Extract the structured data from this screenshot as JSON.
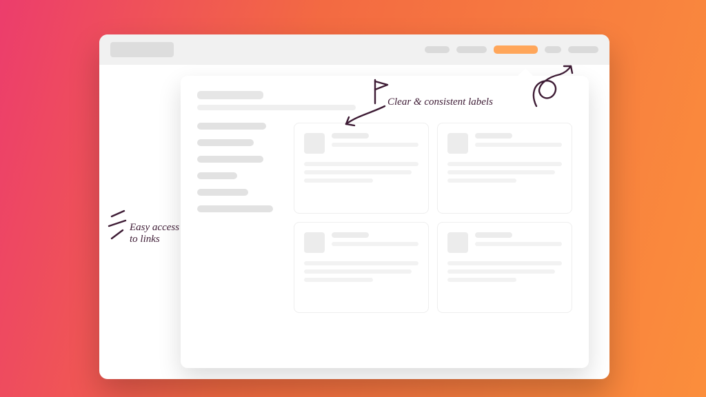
{
  "colors": {
    "gradient_start": "#EC3D6C",
    "gradient_mid": "#F36A42",
    "gradient_end": "#FB8E3C",
    "accent": "#FFA65A",
    "sketch": "#3d1b34"
  },
  "browser": {
    "topbar": {
      "logo_placeholder": "",
      "nav_items": [
        {
          "label": "",
          "active": false
        },
        {
          "label": "",
          "active": false
        },
        {
          "label": "",
          "active": true
        },
        {
          "label": "",
          "active": false
        },
        {
          "label": "",
          "active": false
        }
      ]
    }
  },
  "megamenu": {
    "title_placeholder": "",
    "subtitle_placeholder": "",
    "sidebar_links": [
      "",
      "",
      "",
      "",
      "",
      ""
    ],
    "cards": [
      {
        "thumb": "",
        "title": "",
        "subtitle": "",
        "lines": [
          "",
          "",
          ""
        ]
      },
      {
        "thumb": "",
        "title": "",
        "subtitle": "",
        "lines": [
          "",
          "",
          ""
        ]
      },
      {
        "thumb": "",
        "title": "",
        "subtitle": "",
        "lines": [
          "",
          "",
          ""
        ]
      },
      {
        "thumb": "",
        "title": "",
        "subtitle": "",
        "lines": [
          "",
          "",
          ""
        ]
      }
    ]
  },
  "annotations": {
    "labels": "Clear & consistent labels",
    "links": "Easy access\nto links"
  }
}
